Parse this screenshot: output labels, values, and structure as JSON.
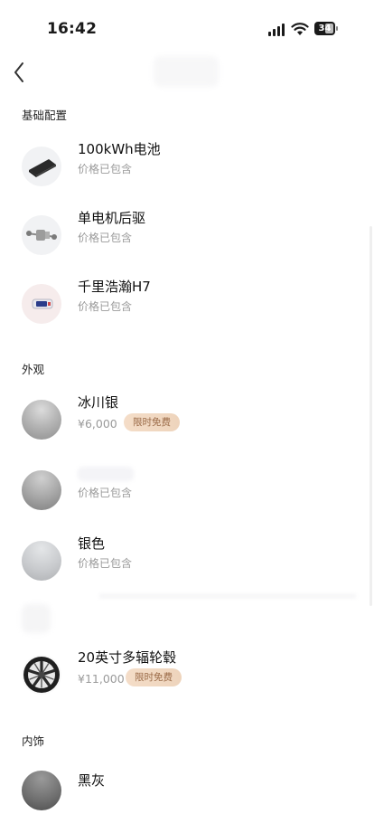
{
  "status_bar": {
    "time": "16:42",
    "battery_level": "34"
  },
  "sections": {
    "basic": "基础配置",
    "exterior": "外观",
    "interior": "内饰"
  },
  "basic_items": [
    {
      "title": "100kWh电池",
      "subtitle": "价格已包含",
      "icon": "battery-pack-icon"
    },
    {
      "title": "单电机后驱",
      "subtitle": "价格已包含",
      "icon": "motor-drive-icon"
    },
    {
      "title": "千里浩瀚H7",
      "subtitle": "价格已包含",
      "icon": "chip-icon"
    }
  ],
  "exterior_items": [
    {
      "title": "冰川银",
      "price": "¥6,000",
      "badge": "限时免费"
    },
    {
      "title": "",
      "subtitle": "价格已包含"
    },
    {
      "title": "银色",
      "subtitle": "价格已包含"
    },
    {
      "title": "20英寸多辐轮毂",
      "price": "¥11,000",
      "badge": "限时免费"
    }
  ],
  "interior_items": [
    {
      "title": "黑灰"
    }
  ],
  "colors": {
    "badge_text": "#9a6a47",
    "badge_bg": "#f2dac4"
  }
}
